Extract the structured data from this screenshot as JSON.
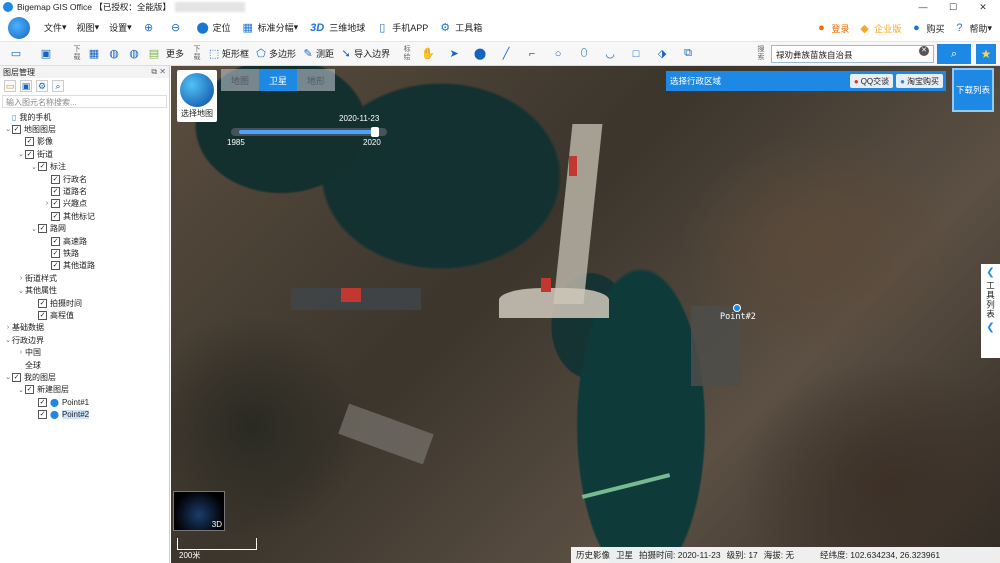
{
  "titlebar": {
    "title": "Bigemap GIS Office 【已授权：全能版】",
    "minimize": "—",
    "maximize": "☐",
    "close": "✕"
  },
  "menu": {
    "file": "文件",
    "view": "视图",
    "settings": "设置",
    "locate": "定位",
    "standard_sheet": "标准分幅",
    "earth_3d_icon_text": "3D",
    "earth_3d": "三维地球",
    "mobile_app": "手机APP",
    "toolbox": "工具箱",
    "login": "登录",
    "enterprise": "企业版",
    "buy": "购买",
    "help": "帮助"
  },
  "toolbar": {
    "download_label": "下载",
    "more": "更多",
    "rectangle": "矩形框",
    "polygon": "多边形",
    "measure": "测距",
    "import_boundary": "导入边界",
    "annotate_label": "标绘",
    "search_label": "搜索",
    "search_value": "禄劝彝族苗族自治县"
  },
  "left_panel": {
    "title": "图层管理",
    "filter_placeholder": "输入图元名称搜索...",
    "tree": [
      {
        "label": "我的手机",
        "depth": 0,
        "arrow": "",
        "checkbox": false,
        "icon": "phone"
      },
      {
        "label": "地图图层",
        "depth": 0,
        "arrow": "v",
        "checkbox": true
      },
      {
        "label": "影像",
        "depth": 1,
        "arrow": "",
        "checkbox": true
      },
      {
        "label": "街道",
        "depth": 1,
        "arrow": "v",
        "checkbox": true
      },
      {
        "label": "标注",
        "depth": 2,
        "arrow": "v",
        "checkbox": true
      },
      {
        "label": "行政名",
        "depth": 3,
        "arrow": "",
        "checkbox": true
      },
      {
        "label": "道路名",
        "depth": 3,
        "arrow": "",
        "checkbox": true
      },
      {
        "label": "兴趣点",
        "depth": 3,
        "arrow": ">",
        "checkbox": true
      },
      {
        "label": "其他标记",
        "depth": 3,
        "arrow": "",
        "checkbox": true
      },
      {
        "label": "路网",
        "depth": 2,
        "arrow": "v",
        "checkbox": true
      },
      {
        "label": "高速路",
        "depth": 3,
        "arrow": "",
        "checkbox": true
      },
      {
        "label": "铁路",
        "depth": 3,
        "arrow": "",
        "checkbox": true
      },
      {
        "label": "其他道路",
        "depth": 3,
        "arrow": "",
        "checkbox": true
      },
      {
        "label": "街道样式",
        "depth": 1,
        "arrow": ">",
        "checkbox": false
      },
      {
        "label": "其他属性",
        "depth": 1,
        "arrow": "v",
        "checkbox": false
      },
      {
        "label": "拍摄时间",
        "depth": 2,
        "arrow": "",
        "checkbox": true
      },
      {
        "label": "高程值",
        "depth": 2,
        "arrow": "",
        "checkbox": true
      },
      {
        "label": "基础数据",
        "depth": 0,
        "arrow": ">",
        "checkbox": false
      },
      {
        "label": "行政边界",
        "depth": 0,
        "arrow": "v",
        "checkbox": false
      },
      {
        "label": "中国",
        "depth": 1,
        "arrow": ">",
        "checkbox": false
      },
      {
        "label": "全球",
        "depth": 1,
        "arrow": "",
        "checkbox": false
      },
      {
        "label": "我的图层",
        "depth": 0,
        "arrow": "v",
        "checkbox": true
      },
      {
        "label": "新建图层",
        "depth": 1,
        "arrow": "v",
        "checkbox": true
      },
      {
        "label": "Point#1",
        "depth": 2,
        "arrow": "",
        "checkbox": true,
        "icon": "pin"
      },
      {
        "label": "Point#2",
        "depth": 2,
        "arrow": "",
        "checkbox": true,
        "icon": "pin",
        "selected": true
      }
    ]
  },
  "map": {
    "tabs": [
      "地图",
      "卫星",
      "地形"
    ],
    "active_tab": "卫星",
    "select_map": "选择地图",
    "timeline": {
      "date": "2020-11-23",
      "start_year": "1985",
      "end_year": "2020",
      "progress": 0.92
    },
    "region_select": "选择行政区域",
    "qq_chat": "QQ交谈",
    "taobao_buy": "淘宝购买",
    "download_list": "下载列表",
    "tool_list": "工具列表",
    "point_label": "Point#2",
    "mini_globe_3d": "3D",
    "scale_label": "200米",
    "status": {
      "history": "历史影像",
      "layer": "卫星",
      "shot_time": "拍摄时间: 2020-11-23",
      "level": "级别:  17",
      "elevation": "海拔: 无",
      "coords": "经纬度:  102.634234, 26.323961"
    }
  },
  "colors": {
    "accent": "#1e88e5",
    "water": "#133131",
    "terrain": "#5a4d3f"
  }
}
